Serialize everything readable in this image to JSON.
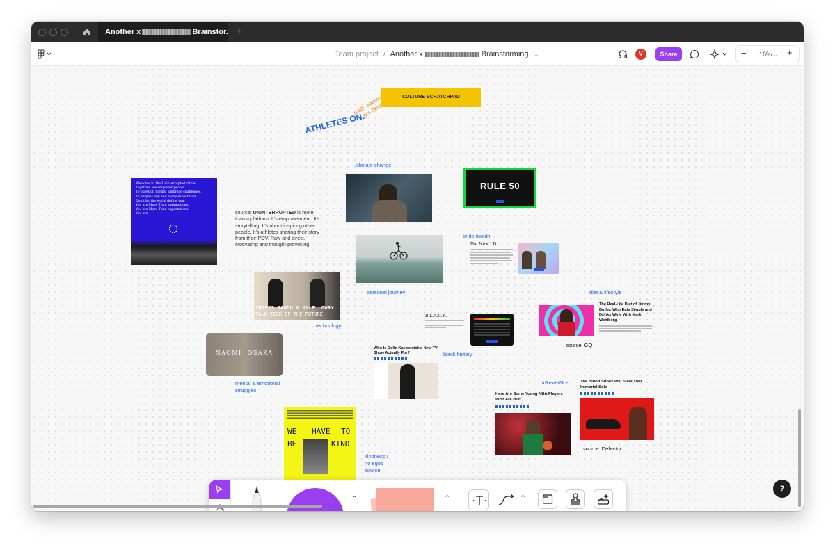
{
  "window": {
    "tab_title_prefix": "Another x",
    "tab_title_suffix": "Brainstor...",
    "new_tab": "+"
  },
  "toolbar": {
    "project": "Team project",
    "separator": "/",
    "file_prefix": "Another x",
    "file_suffix": "Brainstorming",
    "avatar_initial": "V",
    "share_label": "Share",
    "zoom_level": "16%",
    "zoom_out": "−",
    "zoom_in": "+"
  },
  "canvas": {
    "zoom_note": "really zoomed out here",
    "scratchpad_title": "CULTURE SCRATCHPAD",
    "heading": "ATHLETES ON:",
    "labels": {
      "climate_change": "climate change",
      "pride_month": "pride month",
      "personal_journey": "personal journey",
      "diet_lifestyle": "diet & lifestyle",
      "technology": "technology",
      "black_history": "black history",
      "mental_emotional_1": "mental & emotional",
      "mental_emotional_2": "struggles",
      "irreverence": "irReVerNce",
      "kindness_1": "kindness /",
      "kindness_2": "no egos",
      "kindness_source": "source"
    },
    "uninterrupted": {
      "poster_lines": [
        "Welcome to the Uninterrupted circle.",
        "Together, we empower people.",
        "To question norms. Embrace challenges.",
        "To surpass any and every expectation.",
        "Don't let the world define you.",
        "You are More Than assumptions.",
        "You are More Than expectations.",
        "You are"
      ],
      "source_prefix": "source:",
      "source_name": "UNINTERRUPTED",
      "description": "is more than a platform. It's empowerment. It's storytelling. It's about inspiring other people. It's athletes sharing their story from their POV. Raw and direct. Motivating and thought-provoking."
    },
    "rule50": {
      "title": "RULE 50"
    },
    "new_id": {
      "title": "The New I.D."
    },
    "tech_video": {
      "line1": "IDDRIS SANDU & KYLE LOWRY",
      "line2": "TALK TECH OF THE FUTURE"
    },
    "black": {
      "title": "B.L.A.C.K."
    },
    "naomi": {
      "text": "NAOMI  OSAKA"
    },
    "kaepernick": {
      "headline": "Who Is Colin Kaepernick's New TV Show Actually For?"
    },
    "butler": {
      "headline": "The Real-Life Diet of Jimmy Butler, Who Eats Simply and Drinks Wine With Mark Wahlberg",
      "source": "source: GQ"
    },
    "nba": {
      "headline": "Here Are Some Young NBA Players Who Are Butt"
    },
    "blood_shoes": {
      "headline": "The Blood Shoes Will Steal Your Immortal Sole",
      "source": "source: Defector"
    },
    "kind_poster": {
      "word1": "WE",
      "word2": "HAVE",
      "word3": "TO",
      "word4": "BE",
      "word5": "KIND"
    }
  },
  "help_label": "?",
  "colors": {
    "accent": "#9a3ef0",
    "link_blue": "#1a62e8",
    "scratchpad": "#f5c400",
    "sticky": "#f9a99b"
  }
}
